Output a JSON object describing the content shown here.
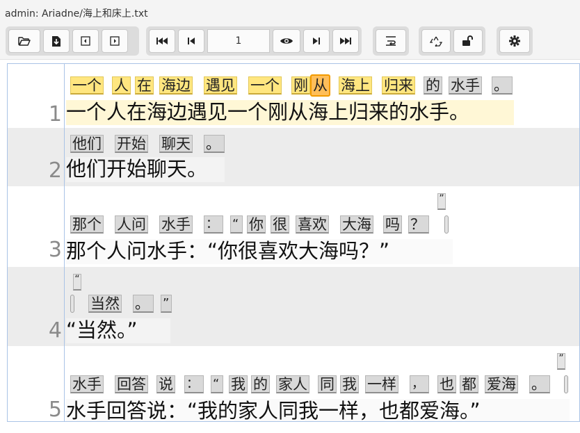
{
  "window": {
    "title": "admin: Ariadne/海上和床上.txt"
  },
  "toolbar": {
    "page": "1",
    "icons": [
      "folder-open-icon",
      "download-icon",
      "panel-left-icon",
      "panel-right-icon",
      "first-page-icon",
      "prev-page-icon",
      "eye-icon",
      "next-page-icon",
      "last-page-icon",
      "wrap-text-icon",
      "recycle-icon",
      "unlock-icon",
      "gear-icon"
    ]
  },
  "lines": [
    {
      "number": "1",
      "text": "一个人在海边遇见一个刚从海上归来的水手。",
      "tokens": [
        "一个",
        "人",
        "在",
        "海边",
        "遇见",
        "一个",
        "刚",
        "从",
        "海上",
        "归来",
        "的",
        "水手",
        "。"
      ]
    },
    {
      "number": "2",
      "text": "他们开始聊天。",
      "tokens": [
        "他们",
        "开始",
        "聊天",
        "。"
      ]
    },
    {
      "number": "3",
      "text": "那个人问水手：“你很喜欢大海吗？”",
      "tokens": [
        "那个",
        "人问",
        "水手",
        "：",
        "“",
        "你",
        "很",
        "喜欢",
        "大海",
        "吗",
        "？",
        "”"
      ]
    },
    {
      "number": "4",
      "text": "“当然。”",
      "tokens": [
        "“",
        "当然",
        "。",
        "”"
      ]
    },
    {
      "number": "5",
      "text": "水手回答说：“我的家人同我一样，也都爱海。”",
      "tokens": [
        "水手",
        "回答",
        "说",
        "：",
        "“",
        "我",
        "的",
        "家人",
        "同",
        "我",
        "一样",
        "，",
        "也",
        "都",
        "爱海",
        "。",
        "”"
      ]
    }
  ]
}
